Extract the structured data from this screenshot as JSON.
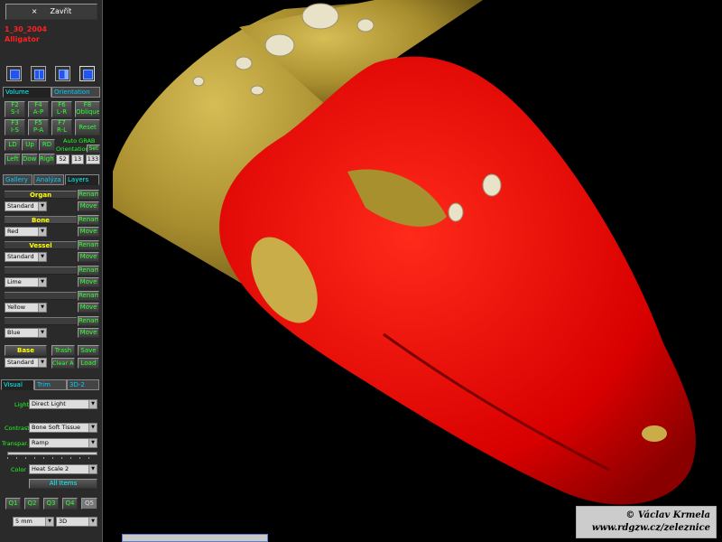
{
  "title_bar": {
    "close_label": "Zavřít"
  },
  "study": {
    "date": "1_30_2004",
    "name": "Alligator"
  },
  "view_tabs": {
    "volume": "Volume",
    "orientation": "Orientation"
  },
  "fkeys": [
    {
      "key": "F2",
      "dir": "S-I"
    },
    {
      "key": "F4",
      "dir": "A-P"
    },
    {
      "key": "F6",
      "dir": "L-R"
    },
    {
      "key": "F8",
      "dir": "Oblique"
    },
    {
      "key": "F3",
      "dir": "I-S"
    },
    {
      "key": "F5",
      "dir": "P-A"
    },
    {
      "key": "F7",
      "dir": "R-L"
    }
  ],
  "orient": {
    "reset": "Reset",
    "ld": "LD",
    "up": "Up",
    "rd": "RD",
    "auto_grab": "Auto GRAB",
    "orientation": "Orientation",
    "set": "Set",
    "left": "Left",
    "down": "Down",
    "right": "Right",
    "v1": "52",
    "v2": "13",
    "v3": "133"
  },
  "layer_tabs": {
    "gallery": "Gallery",
    "analyze": "Analýza",
    "layers": "Layers"
  },
  "layers": {
    "organ": "Organ",
    "bone": "Bone",
    "vessel": "Vessel",
    "base": "Base",
    "rename": "Rename",
    "move": "Move",
    "trash": "Trash",
    "save": "Save",
    "clear_all": "Clear All",
    "load": "Load",
    "sel_standard": "Standard",
    "sel_red": "Red",
    "sel_standard2": "Standard",
    "sel_lime": "Lime",
    "sel_yellow": "Yellow",
    "sel_blue": "Blue",
    "sel_standard3": "Standard"
  },
  "visual_tabs": {
    "visual": "Visual",
    "trim": "Trim",
    "d3": "3D-2"
  },
  "visual": {
    "light_label": "Light",
    "light": "Direct Light",
    "contrast_label": "Contrast",
    "contrast": "Bone Soft Tissue",
    "transp_label": "Transpar.",
    "transp": "Ramp",
    "color_label": "Color",
    "color": "Heat Scale 2",
    "all_items": "All Items",
    "q": [
      "Q1",
      "Q2",
      "Q3",
      "Q4",
      "Q5"
    ],
    "thickness": "5 mm",
    "mode": "3D"
  },
  "watermark": {
    "author": "© Václav Krmela",
    "url": "www.rdgzw.cz/zeleznice"
  },
  "colors": {
    "bone": "#e60000",
    "tissue": "#b59a3a",
    "panel": "#2a2a2a"
  }
}
